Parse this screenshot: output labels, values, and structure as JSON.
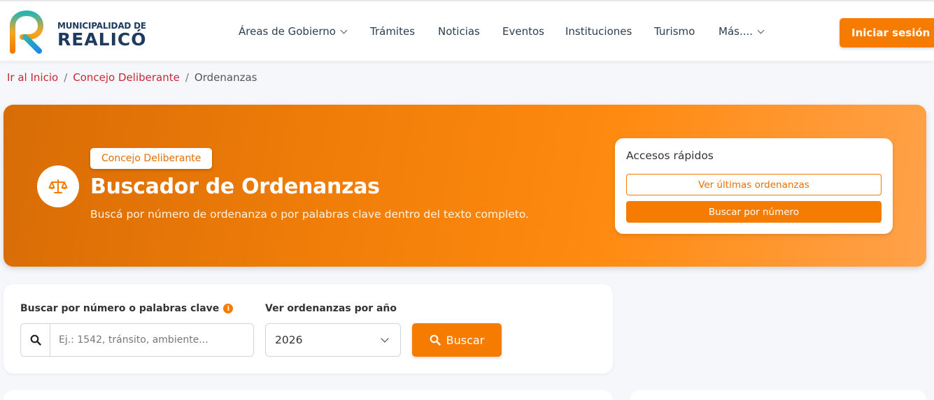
{
  "header": {
    "logo_small": "MUNICIPALIDAD DE",
    "logo_big": "REALICÓ",
    "nav": [
      {
        "label": "Áreas de Gobierno",
        "dropdown": true
      },
      {
        "label": "Trámites",
        "dropdown": false
      },
      {
        "label": "Noticias",
        "dropdown": false
      },
      {
        "label": "Eventos",
        "dropdown": false
      },
      {
        "label": "Instituciones",
        "dropdown": false
      },
      {
        "label": "Turismo",
        "dropdown": false
      },
      {
        "label": "Más....",
        "dropdown": true
      }
    ],
    "login_label": "Iniciar sesión"
  },
  "breadcrumb": {
    "home": "Ir al Inicio",
    "section": "Concejo Deliberante",
    "current": "Ordenanzas",
    "separator": "/"
  },
  "hero": {
    "badge": "Concejo Deliberante",
    "title": "Buscador de Ordenanzas",
    "subtitle": "Buscá por número de ordenanza o por palabras clave dentro del texto completo.",
    "icon": "scale-balance-icon"
  },
  "quick_access": {
    "title": "Accesos rápidos",
    "latest_label": "Ver últimas ordenanzas",
    "by_number_label": "Buscar por número"
  },
  "search": {
    "keyword_label": "Buscar por número o palabras clave",
    "keyword_placeholder": "Ej.: 1542, tránsito, ambiente...",
    "year_label": "Ver ordenanzas por año",
    "year_selected": "2026",
    "button_label": "Buscar"
  },
  "colors": {
    "accent": "#f57c00",
    "navy": "#1e3a5f",
    "link_red": "#c62834"
  }
}
